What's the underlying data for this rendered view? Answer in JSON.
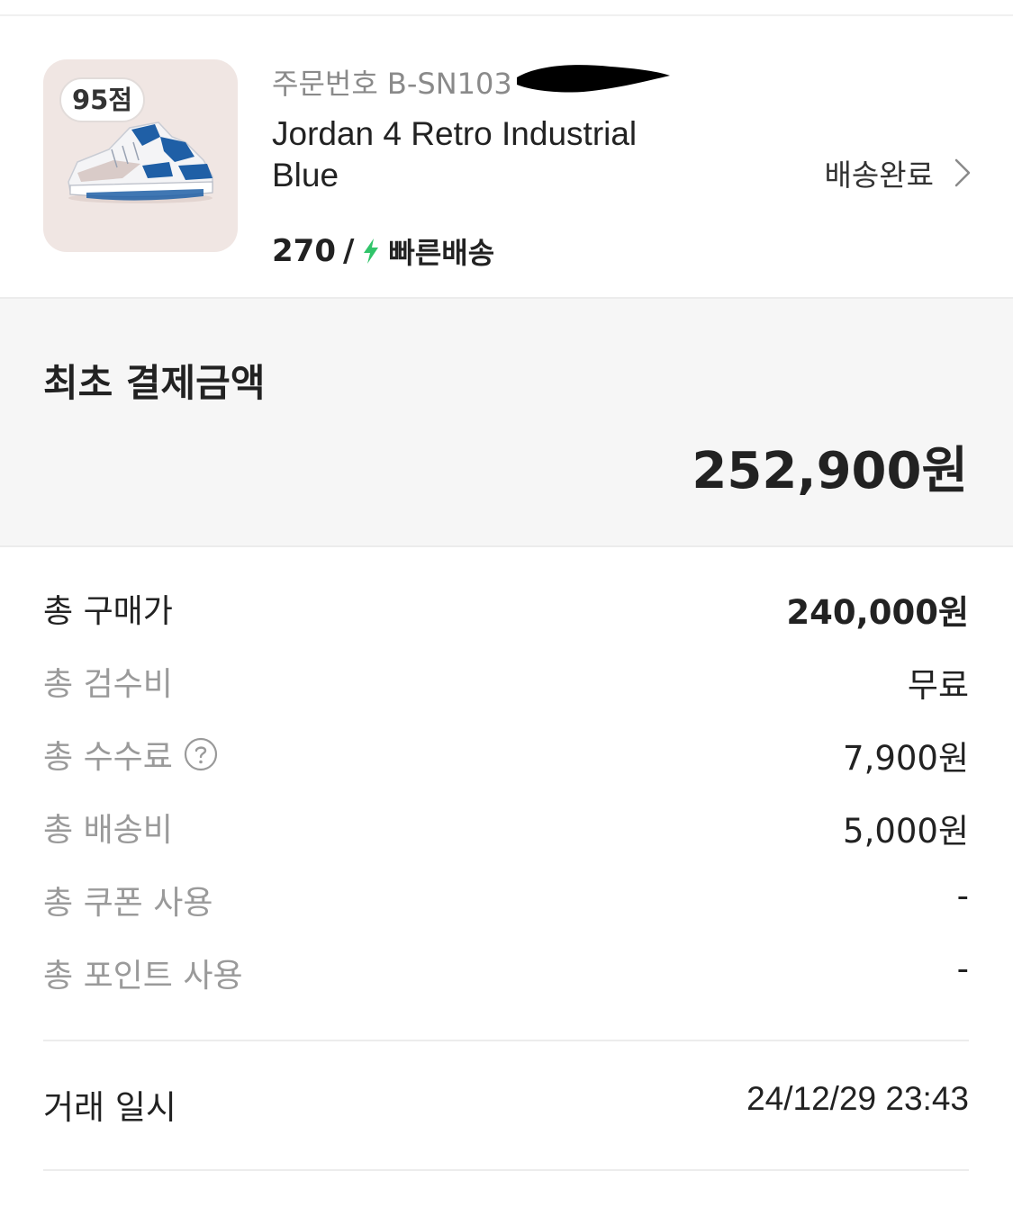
{
  "product": {
    "score_badge": "95점",
    "order_number": "주문번호 B-SN103",
    "name": "Jordan 4 Retro Industrial Blue",
    "size": "270",
    "separator": "/",
    "shipping_type": "빠른배송",
    "status": "배송완료",
    "image_icon": "sneaker-image",
    "shipping_icon": "lightning-bolt-icon",
    "accent_color": "#31c46a",
    "shoe_color": "#1f5fa6"
  },
  "payment_summary": {
    "title": "최초 결제금액",
    "amount": "252,900원"
  },
  "breakdown": [
    {
      "label": "총 구매가",
      "value": "240,000원"
    },
    {
      "label": "총 검수비",
      "value": "무료"
    },
    {
      "label": "총 수수료",
      "value": "7,900원"
    },
    {
      "label": "총 배송비",
      "value": "5,000원"
    },
    {
      "label": "총 쿠폰 사용",
      "value": "-"
    },
    {
      "label": "총 포인트 사용",
      "value": "-"
    }
  ],
  "transaction": {
    "label": "거래 일시",
    "datetime": "24/12/29 23:43"
  }
}
